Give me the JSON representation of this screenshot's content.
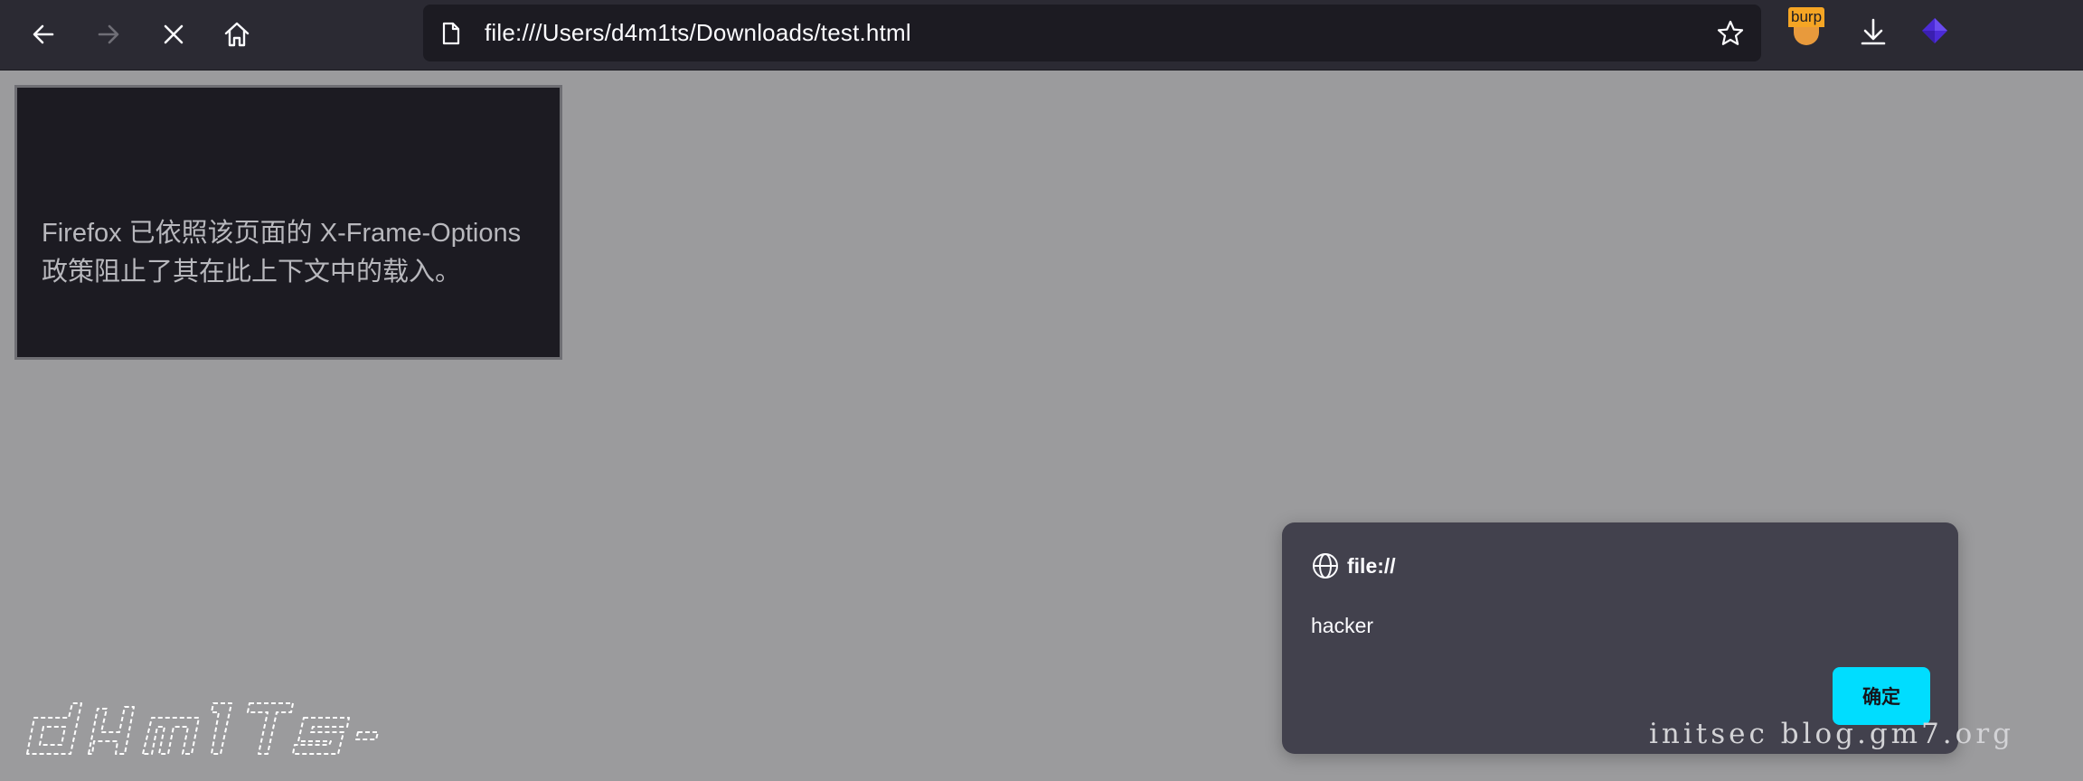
{
  "browser": {
    "address_bar": {
      "url": "file:///Users/d4m1ts/Downloads/test.html"
    },
    "toolbar": {
      "back_icon": "arrow-left-icon",
      "forward_icon": "arrow-right-icon",
      "stop_icon": "close-icon",
      "home_icon": "home-icon",
      "bookmark_icon": "star-icon",
      "download_icon": "download-icon"
    },
    "extensions": [
      {
        "name": "burp-extension",
        "label": "burp"
      },
      {
        "name": "cube-extension",
        "icon": "cube-icon",
        "color": "#4c2bd6"
      }
    ]
  },
  "content": {
    "blocked_frame_message": "Firefox 已依照该页面的 X-Frame-Options 政策阻止了其在此上下文中的载入。"
  },
  "alert_dialog": {
    "origin": "file://",
    "message": "hacker",
    "ok_button": "确定",
    "accent_color": "#00ddff"
  },
  "watermarks": {
    "logo_text": "d4m1ts",
    "site_text": "initsec blog.gm7.org"
  }
}
